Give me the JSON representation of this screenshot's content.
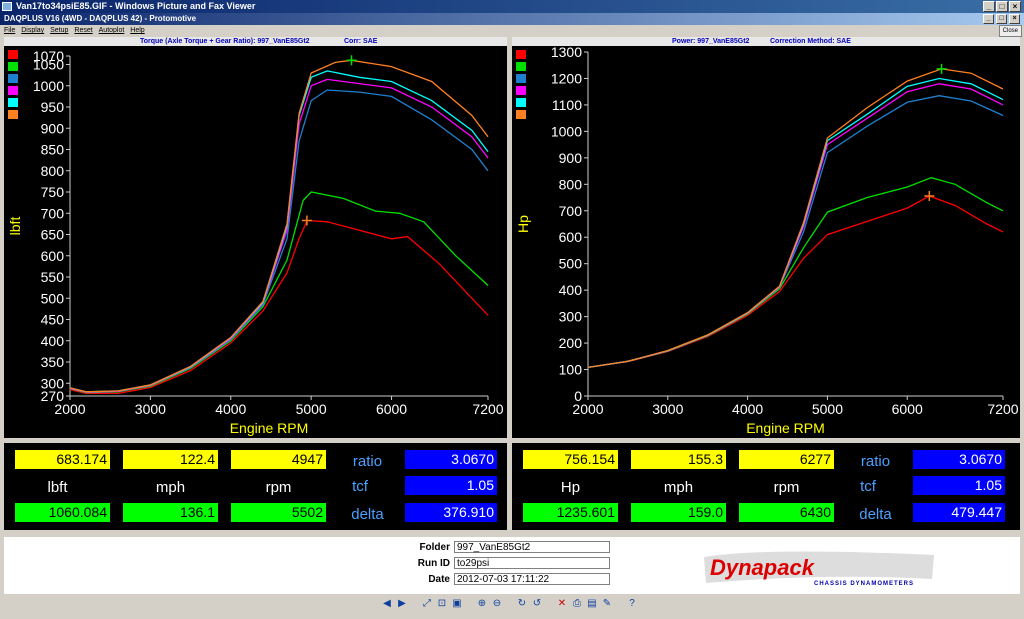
{
  "window": {
    "title": "Van17to34psiE85.GIF - Windows Picture and Fax Viewer"
  },
  "app": {
    "title": "DAQPLUS V16 (4WD - DAQPLUS 42) - Protomotive",
    "close_label": "Close"
  },
  "menu": [
    "File",
    "Display",
    "Setup",
    "Reset",
    "Autoplot",
    "Help"
  ],
  "torque_chart": {
    "title": "Torque (Axle Torque + Gear Ratio): 997_VanE85Gt2",
    "corr": "Corr: SAE"
  },
  "power_chart": {
    "title": "Power: 997_VanE85Gt2",
    "corr": "Correction Method: SAE"
  },
  "series_colors": [
    "#ff0000",
    "#00e000",
    "#2080d0",
    "#ff00ff",
    "#00ffff",
    "#ff8020"
  ],
  "chart_data": [
    {
      "type": "line",
      "ylabel": "lbft",
      "xlabel": "Engine RPM",
      "xlim": [
        2000,
        7200
      ],
      "ylim": [
        270,
        1070
      ],
      "yticks": [
        270,
        300,
        350,
        400,
        450,
        500,
        550,
        600,
        650,
        700,
        750,
        800,
        850,
        900,
        950,
        1000,
        1050,
        1070
      ],
      "xticks": [
        2000,
        3000,
        4000,
        5000,
        6000,
        7200
      ],
      "series": [
        {
          "color": "#ff0000",
          "points": [
            [
              2000,
              285
            ],
            [
              2200,
              276
            ],
            [
              2600,
              276
            ],
            [
              3000,
              290
            ],
            [
              3500,
              330
            ],
            [
              4000,
              395
            ],
            [
              4400,
              470
            ],
            [
              4700,
              560
            ],
            [
              4850,
              640
            ],
            [
              4950,
              683
            ],
            [
              5200,
              680
            ],
            [
              5600,
              660
            ],
            [
              6000,
              640
            ],
            [
              6200,
              645
            ],
            [
              6600,
              580
            ],
            [
              7000,
              500
            ],
            [
              7200,
              460
            ]
          ]
        },
        {
          "color": "#00e000",
          "points": [
            [
              2000,
              287
            ],
            [
              2200,
              278
            ],
            [
              2600,
              280
            ],
            [
              3000,
              293
            ],
            [
              3500,
              335
            ],
            [
              4000,
              400
            ],
            [
              4400,
              480
            ],
            [
              4700,
              590
            ],
            [
              4900,
              730
            ],
            [
              5000,
              750
            ],
            [
              5400,
              735
            ],
            [
              5800,
              705
            ],
            [
              6100,
              700
            ],
            [
              6400,
              680
            ],
            [
              6800,
              600
            ],
            [
              7000,
              565
            ],
            [
              7200,
              530
            ]
          ]
        },
        {
          "color": "#2080d0",
          "points": [
            [
              2000,
              288
            ],
            [
              2200,
              279
            ],
            [
              2600,
              281
            ],
            [
              3000,
              295
            ],
            [
              3500,
              337
            ],
            [
              4000,
              403
            ],
            [
              4400,
              485
            ],
            [
              4700,
              640
            ],
            [
              4850,
              870
            ],
            [
              5000,
              965
            ],
            [
              5200,
              990
            ],
            [
              5600,
              985
            ],
            [
              6000,
              975
            ],
            [
              6500,
              920
            ],
            [
              7000,
              850
            ],
            [
              7200,
              800
            ]
          ]
        },
        {
          "color": "#ff00ff",
          "points": [
            [
              2000,
              288
            ],
            [
              2200,
              279
            ],
            [
              2600,
              281
            ],
            [
              3000,
              295
            ],
            [
              3500,
              338
            ],
            [
              4000,
              405
            ],
            [
              4400,
              488
            ],
            [
              4700,
              660
            ],
            [
              4850,
              910
            ],
            [
              5000,
              1000
            ],
            [
              5200,
              1015
            ],
            [
              5600,
              1005
            ],
            [
              6000,
              995
            ],
            [
              6500,
              950
            ],
            [
              7000,
              880
            ],
            [
              7200,
              830
            ]
          ]
        },
        {
          "color": "#00ffff",
          "points": [
            [
              2000,
              289
            ],
            [
              2200,
              280
            ],
            [
              2600,
              282
            ],
            [
              3000,
              296
            ],
            [
              3500,
              339
            ],
            [
              4000,
              407
            ],
            [
              4400,
              490
            ],
            [
              4700,
              670
            ],
            [
              4850,
              930
            ],
            [
              5000,
              1020
            ],
            [
              5200,
              1035
            ],
            [
              5600,
              1020
            ],
            [
              6000,
              1010
            ],
            [
              6500,
              965
            ],
            [
              7000,
              895
            ],
            [
              7200,
              845
            ]
          ]
        },
        {
          "color": "#ff8020",
          "points": [
            [
              2000,
              289
            ],
            [
              2200,
              280
            ],
            [
              2600,
              282
            ],
            [
              3000,
              296
            ],
            [
              3500,
              340
            ],
            [
              4000,
              408
            ],
            [
              4400,
              492
            ],
            [
              4700,
              675
            ],
            [
              4850,
              935
            ],
            [
              5000,
              1030
            ],
            [
              5300,
              1055
            ],
            [
              5500,
              1060
            ],
            [
              6000,
              1045
            ],
            [
              6500,
              1010
            ],
            [
              7000,
              930
            ],
            [
              7200,
              880
            ]
          ]
        }
      ],
      "markers": [
        {
          "x": 4947,
          "y": 683,
          "color": "#ff8020"
        },
        {
          "x": 5502,
          "y": 1060,
          "color": "#00e000"
        }
      ]
    },
    {
      "type": "line",
      "ylabel": "Hp",
      "xlabel": "Engine RPM",
      "xlim": [
        2000,
        7200
      ],
      "ylim": [
        0,
        1300
      ],
      "yticks": [
        0,
        100,
        200,
        300,
        400,
        500,
        600,
        700,
        800,
        900,
        1000,
        1100,
        1200,
        1300
      ],
      "xticks": [
        2000,
        3000,
        4000,
        5000,
        6000,
        7200
      ],
      "series": [
        {
          "color": "#ff0000",
          "points": [
            [
              2000,
              108
            ],
            [
              2500,
              130
            ],
            [
              3000,
              168
            ],
            [
              3500,
              225
            ],
            [
              4000,
              305
            ],
            [
              4400,
              395
            ],
            [
              4700,
              520
            ],
            [
              5000,
              610
            ],
            [
              5500,
              660
            ],
            [
              6000,
              710
            ],
            [
              6277,
              756
            ],
            [
              6600,
              720
            ],
            [
              7000,
              650
            ],
            [
              7200,
              620
            ]
          ]
        },
        {
          "color": "#00e000",
          "points": [
            [
              2000,
              108
            ],
            [
              2500,
              131
            ],
            [
              3000,
              170
            ],
            [
              3500,
              228
            ],
            [
              4000,
              310
            ],
            [
              4400,
              405
            ],
            [
              4700,
              560
            ],
            [
              5000,
              695
            ],
            [
              5500,
              750
            ],
            [
              6000,
              790
            ],
            [
              6300,
              825
            ],
            [
              6600,
              800
            ],
            [
              7000,
              730
            ],
            [
              7200,
              700
            ]
          ]
        },
        {
          "color": "#2080d0",
          "points": [
            [
              2000,
              108
            ],
            [
              2500,
              131
            ],
            [
              3000,
              170
            ],
            [
              3500,
              229
            ],
            [
              4000,
              312
            ],
            [
              4400,
              410
            ],
            [
              4700,
              620
            ],
            [
              5000,
              920
            ],
            [
              5500,
              1020
            ],
            [
              6000,
              1110
            ],
            [
              6400,
              1135
            ],
            [
              6800,
              1115
            ],
            [
              7200,
              1060
            ]
          ]
        },
        {
          "color": "#ff00ff",
          "points": [
            [
              2000,
              108
            ],
            [
              2500,
              131
            ],
            [
              3000,
              171
            ],
            [
              3500,
              230
            ],
            [
              4000,
              313
            ],
            [
              4400,
              412
            ],
            [
              4700,
              640
            ],
            [
              5000,
              950
            ],
            [
              5500,
              1050
            ],
            [
              6000,
              1150
            ],
            [
              6400,
              1180
            ],
            [
              6800,
              1160
            ],
            [
              7200,
              1100
            ]
          ]
        },
        {
          "color": "#00ffff",
          "points": [
            [
              2000,
              108
            ],
            [
              2500,
              131
            ],
            [
              3000,
              171
            ],
            [
              3500,
              230
            ],
            [
              4000,
              314
            ],
            [
              4400,
              414
            ],
            [
              4700,
              650
            ],
            [
              5000,
              965
            ],
            [
              5500,
              1065
            ],
            [
              6000,
              1170
            ],
            [
              6400,
              1200
            ],
            [
              6800,
              1180
            ],
            [
              7200,
              1120
            ]
          ]
        },
        {
          "color": "#ff8020",
          "points": [
            [
              2000,
              108
            ],
            [
              2500,
              131
            ],
            [
              3000,
              172
            ],
            [
              3500,
              231
            ],
            [
              4000,
              315
            ],
            [
              4400,
              415
            ],
            [
              4700,
              655
            ],
            [
              5000,
              975
            ],
            [
              5500,
              1090
            ],
            [
              6000,
              1190
            ],
            [
              6430,
              1236
            ],
            [
              6800,
              1220
            ],
            [
              7200,
              1160
            ]
          ]
        }
      ],
      "markers": [
        {
          "x": 6277,
          "y": 756,
          "color": "#ff8020"
        },
        {
          "x": 6430,
          "y": 1236,
          "color": "#00e000"
        }
      ]
    }
  ],
  "left_readout": {
    "v1": "683.174",
    "v2": "122.4",
    "v3": "4947",
    "u1": "lbft",
    "u2": "mph",
    "u3": "rpm",
    "g1": "1060.084",
    "g2": "136.1",
    "g3": "5502",
    "ratio_label": "ratio",
    "ratio": "3.0670",
    "tcf_label": "tcf",
    "tcf": "1.05",
    "delta_label": "delta",
    "delta": "376.910"
  },
  "right_readout": {
    "v1": "756.154",
    "v2": "155.3",
    "v3": "6277",
    "u1": "Hp",
    "u2": "mph",
    "u3": "rpm",
    "g1": "1235.601",
    "g2": "159.0",
    "g3": "6430",
    "ratio_label": "ratio",
    "ratio": "3.0670",
    "tcf_label": "tcf",
    "tcf": "1.05",
    "delta_label": "delta",
    "delta": "479.447"
  },
  "info": {
    "folder_label": "Folder",
    "folder": "997_VanE85Gt2",
    "runid_label": "Run ID",
    "runid": "to29psi",
    "date_label": "Date",
    "date": "2012-07-03 17:11:22"
  },
  "logo": {
    "brand": "Dynapack",
    "tagline": "CHASSIS DYNAMOMETERS"
  }
}
